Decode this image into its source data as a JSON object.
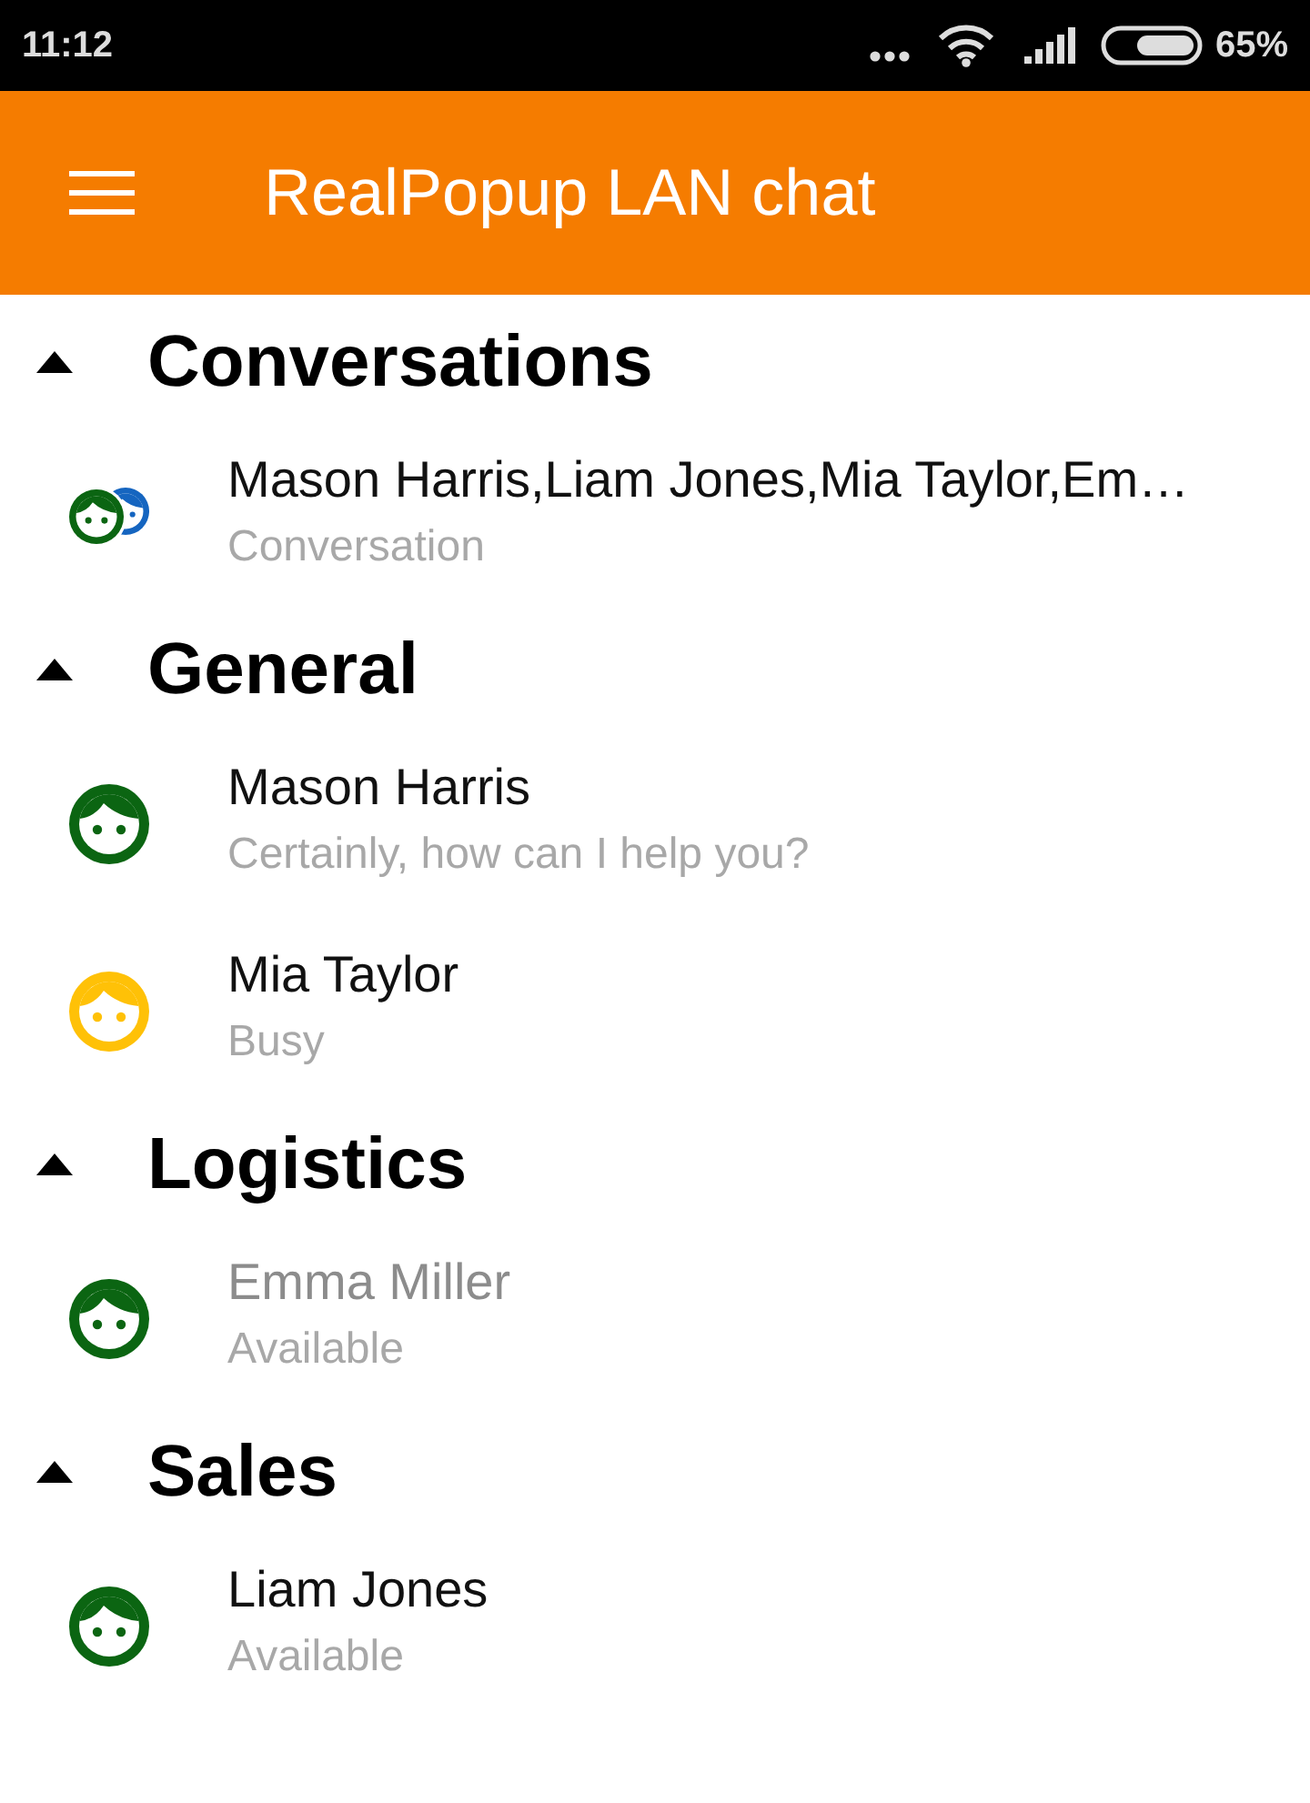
{
  "status_bar": {
    "time": "11:12",
    "battery_percent": "65%"
  },
  "app_bar": {
    "title": "RealPopup LAN chat"
  },
  "groups": [
    {
      "title": "Conversations",
      "expanded": true,
      "items": [
        {
          "kind": "conversation",
          "name": "Mason Harris,Liam Jones,Mia Taylor,Em…",
          "subtitle": "Conversation",
          "disabled": false
        }
      ]
    },
    {
      "title": "General",
      "expanded": true,
      "items": [
        {
          "kind": "contact",
          "name": "Mason Harris",
          "subtitle": "Certainly, how can I help you?",
          "color": "#0b6512",
          "disabled": false
        },
        {
          "kind": "contact",
          "name": "Mia Taylor",
          "subtitle": "Busy",
          "color": "#ffc107",
          "disabled": false
        }
      ]
    },
    {
      "title": "Logistics",
      "expanded": true,
      "items": [
        {
          "kind": "contact",
          "name": "Emma Miller",
          "subtitle": "Available",
          "color": "#0b6512",
          "disabled": true
        }
      ]
    },
    {
      "title": "Sales",
      "expanded": true,
      "items": [
        {
          "kind": "contact",
          "name": "Liam Jones",
          "subtitle": "Available",
          "color": "#0b6512",
          "disabled": false
        }
      ]
    }
  ]
}
